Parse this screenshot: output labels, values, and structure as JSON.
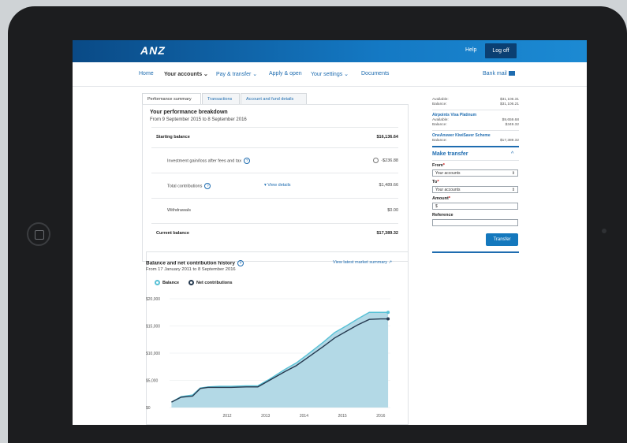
{
  "header": {
    "logo": "ANZ",
    "help": "Help",
    "logoff": "Log off"
  },
  "nav": {
    "items": [
      "Home",
      "Your accounts ⌄",
      "Pay & transfer ⌄",
      "Apply & open",
      "Your settings ⌄",
      "Documents"
    ],
    "bank_mail": "Bank mail"
  },
  "tabs": [
    "Performance summary",
    "Transactions",
    "Account and fund details"
  ],
  "performance": {
    "title": "Your performance breakdown",
    "period": "From 9 September 2015 to 8 September 2016",
    "rows": [
      {
        "label": "Starting balance",
        "value": "$16,136.64"
      },
      {
        "label": "Investment gain/loss after fees and tax",
        "value": "-$236.88"
      },
      {
        "label": "Total contributions",
        "value": "$1,489.66",
        "link": "▾ View details"
      },
      {
        "label": "Withdrawals",
        "value": "$0.00"
      },
      {
        "label": "Current balance",
        "value": "$17,389.32"
      }
    ]
  },
  "history": {
    "title": "Balance and net contribution history",
    "period": "From 17 January 2011 to 8 September 2016",
    "link": "View latest market summary",
    "legend": [
      "Balance",
      "Net contributions"
    ]
  },
  "chart_data": {
    "type": "area",
    "x": [
      2011.05,
      2011.3,
      2011.6,
      2011.8,
      2012.0,
      2012.3,
      2012.6,
      2013.0,
      2013.3,
      2013.6,
      2014.0,
      2014.3,
      2014.6,
      2015.0,
      2015.3,
      2015.6,
      2015.9,
      2016.2,
      2016.5,
      2016.69
    ],
    "series": [
      {
        "name": "Balance",
        "values": [
          1000,
          2000,
          2300,
          3600,
          3800,
          3900,
          3900,
          4000,
          4000,
          5200,
          7000,
          8200,
          9800,
          12000,
          13800,
          15000,
          16300,
          17500,
          17500,
          17500
        ]
      },
      {
        "name": "Net contributions",
        "values": [
          1000,
          1900,
          2100,
          3500,
          3700,
          3700,
          3700,
          3800,
          3800,
          5000,
          6600,
          7700,
          9200,
          11200,
          12800,
          14000,
          15200,
          16200,
          16300,
          16300
        ]
      }
    ],
    "yticks": [
      "$20,000",
      "$15,000",
      "$10,000",
      "$5,000",
      "$0"
    ],
    "xticks": [
      "2012",
      "2013",
      "2014",
      "2015",
      "2016"
    ],
    "ylim": [
      0,
      20000
    ],
    "xlim": [
      2011.0,
      2016.75
    ],
    "colors": {
      "balance": "#58c1d6",
      "net": "#25394f",
      "fill": "#b3d9e6"
    }
  },
  "accounts": {
    "top": [
      {
        "label": "Available:",
        "value": "$31,106.31"
      },
      {
        "label": "Balance:",
        "value": "$31,106.21"
      }
    ],
    "items": [
      {
        "name": "Airpoints Visa Platinum",
        "rows": [
          {
            "label": "Available:",
            "value": "$9,659.68"
          },
          {
            "label": "Balance:",
            "value": "$349.32"
          }
        ]
      },
      {
        "name": "OneAnswer KiwiSaver Scheme",
        "rows": [
          {
            "label": "Balance:",
            "value": "$17,389.32"
          }
        ]
      }
    ]
  },
  "transfer": {
    "title": "Make transfer",
    "from_label": "From",
    "from_value": "Your accounts",
    "to_label": "To",
    "to_value": "Your accounts",
    "amount_label": "Amount",
    "amount_value": "$",
    "reference_label": "Reference",
    "button": "Transfer"
  }
}
